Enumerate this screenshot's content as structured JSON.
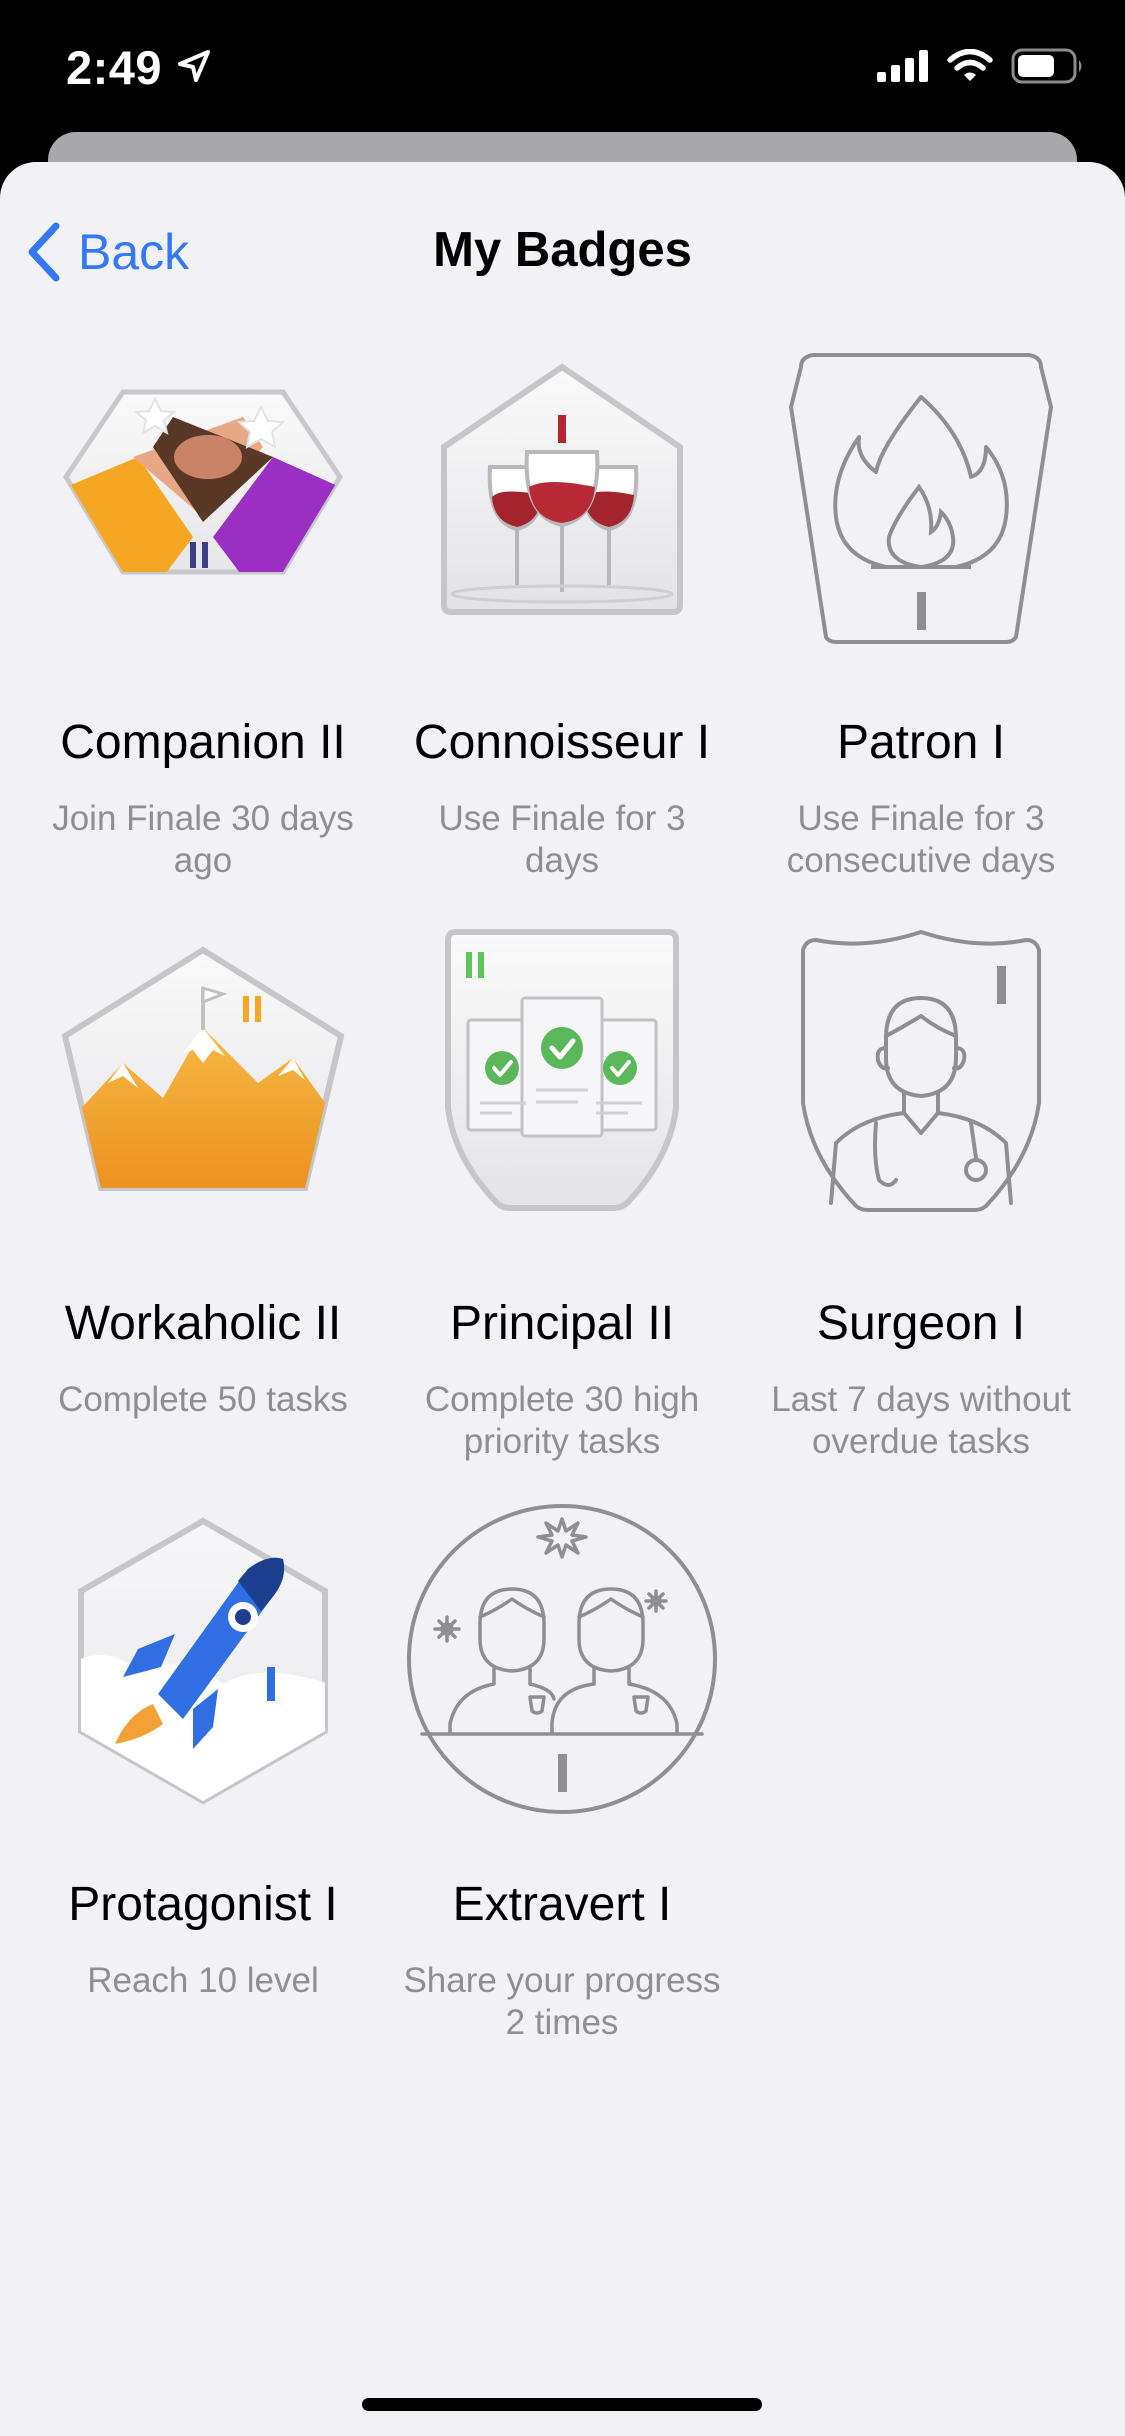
{
  "status_bar": {
    "time": "2:49",
    "location_icon": "location-arrow-icon",
    "signal_icon": "cellular-signal-icon",
    "wifi_icon": "wifi-icon",
    "battery_icon": "battery-icon"
  },
  "nav": {
    "back_label": "Back",
    "back_icon": "chevron-left-icon",
    "title": "My Badges"
  },
  "colors": {
    "accent": "#3478f6",
    "background": "#f1f1f6",
    "secondary_text": "#8e8e93",
    "locked_outline": "#8e8e93"
  },
  "badges": [
    {
      "name": "Companion II",
      "description": "Join Finale 30 days ago",
      "level": "II",
      "icon": "handshake-badge-icon",
      "earned": true
    },
    {
      "name": "Connoisseur I",
      "description": "Use Finale for 3 days",
      "level": "I",
      "icon": "wine-glasses-badge-icon",
      "earned": true
    },
    {
      "name": "Patron I",
      "description": "Use Finale for 3 consecutive days",
      "level": "I",
      "icon": "flame-badge-icon",
      "earned": false
    },
    {
      "name": "Workaholic II",
      "description": "Complete 50 tasks",
      "level": "II",
      "icon": "mountain-flag-badge-icon",
      "earned": true
    },
    {
      "name": "Principal II",
      "description": "Complete 30 high priority tasks",
      "level": "II",
      "icon": "checked-documents-badge-icon",
      "earned": true
    },
    {
      "name": "Surgeon I",
      "description": "Last 7 days without overdue tasks",
      "level": "I",
      "icon": "doctor-badge-icon",
      "earned": false
    },
    {
      "name": "Protagonist I",
      "description": "Reach 10 level",
      "level": "I",
      "icon": "rocket-badge-icon",
      "earned": true
    },
    {
      "name": "Extravert I",
      "description": "Share your progress 2 times",
      "level": "I",
      "icon": "two-people-badge-icon",
      "earned": false
    }
  ]
}
